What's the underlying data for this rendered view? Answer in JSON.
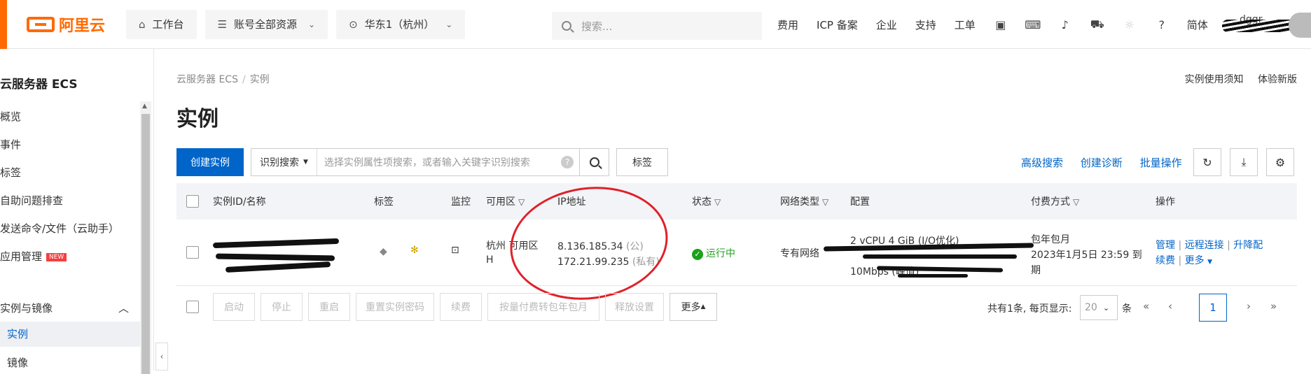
{
  "topbar": {
    "brand": "阿里云",
    "workbench": "工作台",
    "resources": "账号全部资源",
    "region": "华东1（杭州）",
    "search_placeholder": "搜索...",
    "links": [
      "费用",
      "ICP 备案",
      "企业",
      "支持",
      "工单"
    ],
    "lang": "简体",
    "username": "dggr"
  },
  "sidebar": {
    "title": "云服务器 ECS",
    "items": [
      "概览",
      "事件",
      "标签",
      "自助问题排查",
      "发送命令/文件（云助手）",
      "应用管理"
    ],
    "new_badge": "NEW",
    "group": "实例与镜像",
    "active": "实例",
    "next": "镜像"
  },
  "breadcrumb": {
    "root": "云服务器 ECS",
    "current": "实例"
  },
  "header_links": [
    "实例使用须知",
    "体验新版"
  ],
  "page_title": "实例",
  "toolbar": {
    "create": "创建实例",
    "search_type": "识别搜索",
    "search_placeholder": "选择实例属性项搜索，或者输入关键字识别搜索",
    "tag_button": "标签",
    "links": [
      "高级搜索",
      "创建诊断",
      "批量操作"
    ]
  },
  "table": {
    "columns": [
      "实例ID/名称",
      "标签",
      "监控",
      "可用区",
      "IP地址",
      "状态",
      "网络类型",
      "配置",
      "付费方式",
      "操作"
    ],
    "row": {
      "zone_line1": "杭州 可用区",
      "zone_line2": "H",
      "ip_public": "8.136.185.34",
      "ip_public_tag": "(公)",
      "ip_private": "172.21.99.235",
      "ip_private_tag": "(私有)",
      "status": "运行中",
      "network": "专有网络",
      "config_line1": "2 vCPU 4 GiB (I/O优化)",
      "config_line3": "10Mbps (峰值)",
      "billing_line1": "包年包月",
      "billing_line2": "2023年1月5日 23:59 到",
      "billing_line3": "期",
      "actions": {
        "manage": "管理",
        "remote": "远程连接",
        "resize": "升降配",
        "renew": "续费",
        "more": "更多"
      }
    }
  },
  "footer": {
    "buttons": [
      "启动",
      "停止",
      "重启",
      "重置实例密码",
      "续费",
      "按量付费转包年包月",
      "释放设置"
    ],
    "more": "更多",
    "total": "共有1条, 每页显示:",
    "page_size": "20",
    "unit": "条",
    "current_page": "1"
  }
}
